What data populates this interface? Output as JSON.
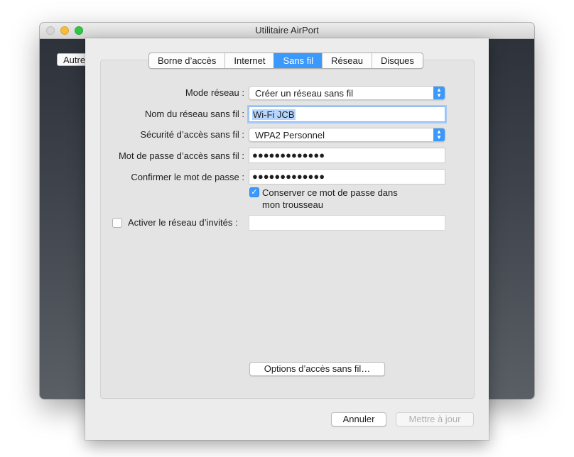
{
  "window": {
    "title": "Utilitaire AirPort",
    "side_button_label": "Autre"
  },
  "tabs": [
    {
      "label": "Borne d’accès",
      "active": false
    },
    {
      "label": "Internet",
      "active": false
    },
    {
      "label": "Sans fil",
      "active": true
    },
    {
      "label": "Réseau",
      "active": false
    },
    {
      "label": "Disques",
      "active": false
    }
  ],
  "form": {
    "mode": {
      "label": "Mode réseau :",
      "value": "Créer un réseau sans fil"
    },
    "network_name": {
      "label": "Nom du réseau sans fil :",
      "value": "Wi-Fi JCB"
    },
    "security": {
      "label": "Sécurité d’accès sans fil :",
      "value": "WPA2 Personnel"
    },
    "password": {
      "label": "Mot de passe d’accès sans fil :",
      "value": "●●●●●●●●●●●●●"
    },
    "confirm_password": {
      "label": "Confirmer le mot de passe :",
      "value": "●●●●●●●●●●●●●"
    },
    "keychain": {
      "label_line1": "Conserver ce mot de passe dans",
      "label_line2": "mon trousseau",
      "checked": true
    },
    "guest_network": {
      "label": "Activer le réseau d’invités :",
      "checked": false,
      "value": ""
    }
  },
  "buttons": {
    "wireless_options": "Options d’accès sans fil…",
    "cancel": "Annuler",
    "update": "Mettre à jour"
  },
  "icons": {
    "checkmark": "checkmark-icon",
    "popup_arrows": "up-down-chevron-icon"
  },
  "colors": {
    "accent": "#3b99fc"
  }
}
